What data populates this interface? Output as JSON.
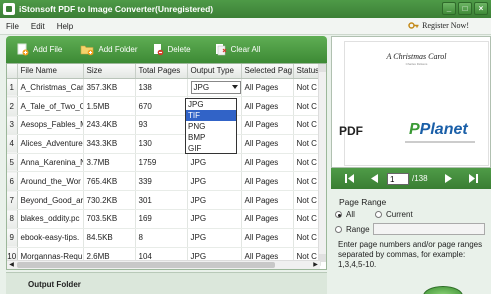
{
  "window": {
    "title": "iStonsoft PDF to Image Converter(Unregistered)",
    "controls": [
      "_",
      "□",
      "×"
    ]
  },
  "menu": {
    "items": [
      "File",
      "Edit",
      "Help"
    ],
    "register_label": "Register Now!"
  },
  "toolbar": {
    "add_file": "Add File",
    "add_folder": "Add Folder",
    "delete": "Delete",
    "clear_all": "Clear All"
  },
  "table": {
    "columns": [
      "",
      "File Name",
      "Size",
      "Total Pages",
      "Output Type",
      "Selected Pag",
      "Status"
    ],
    "rows": [
      {
        "num": "1",
        "name": "A_Christmas_Carol",
        "size": "357.3KB",
        "pages": "138",
        "type": "JPG",
        "selected": "All Pages",
        "status": "Not C"
      },
      {
        "num": "2",
        "name": "A_Tale_of_Two_C",
        "size": "1.5MB",
        "pages": "670",
        "type": "",
        "selected": "All Pages",
        "status": "Not C"
      },
      {
        "num": "3",
        "name": "Aesops_Fables_M",
        "size": "243.4KB",
        "pages": "93",
        "type": "",
        "selected": "All Pages",
        "status": "Not C"
      },
      {
        "num": "4",
        "name": "Alices_Adventure",
        "size": "343.3KB",
        "pages": "130",
        "type": "",
        "selected": "All Pages",
        "status": "Not C"
      },
      {
        "num": "5",
        "name": "Anna_Karenina_N",
        "size": "3.7MB",
        "pages": "1759",
        "type": "JPG",
        "selected": "All Pages",
        "status": "Not C"
      },
      {
        "num": "6",
        "name": "Around_the_Wor",
        "size": "765.4KB",
        "pages": "339",
        "type": "JPG",
        "selected": "All Pages",
        "status": "Not C"
      },
      {
        "num": "7",
        "name": "Beyond_Good_ar",
        "size": "730.2KB",
        "pages": "301",
        "type": "JPG",
        "selected": "All Pages",
        "status": "Not C"
      },
      {
        "num": "8",
        "name": "blakes_oddity.pc",
        "size": "703.5KB",
        "pages": "169",
        "type": "JPG",
        "selected": "All Pages",
        "status": "Not C"
      },
      {
        "num": "9",
        "name": "ebook-easy-tips.",
        "size": "84.5KB",
        "pages": "8",
        "type": "JPG",
        "selected": "All Pages",
        "status": "Not C"
      },
      {
        "num": "10",
        "name": "Morgannas-Requ",
        "size": "2.6MB",
        "pages": "104",
        "type": "JPG",
        "selected": "All Pages",
        "status": "Not C"
      }
    ],
    "hscroll_left": "◀",
    "hscroll_right": "▶"
  },
  "dropdown": {
    "options": [
      "JPG",
      "TIF",
      "PNG",
      "BMP",
      "GIF"
    ],
    "highlighted": "TIF"
  },
  "output": {
    "label": "Output Folder"
  },
  "preview": {
    "page_title": "A Christmas Carol",
    "page_subtitle": "Charles Dickens",
    "logo_left": "PDF",
    "logo_right_1": "Planet",
    "logo_right_2": "P"
  },
  "nav": {
    "current_page": "1",
    "total_pages": "/138"
  },
  "page_range": {
    "label": "Page Range",
    "all": "All",
    "current": "Current",
    "range": "Range",
    "hint": "Enter page numbers and/or page ranges separated by commas, for example: 1,3,4,5-10."
  },
  "colors": {
    "accent_green": "#3d8a35",
    "selection_blue": "#3163c7"
  }
}
